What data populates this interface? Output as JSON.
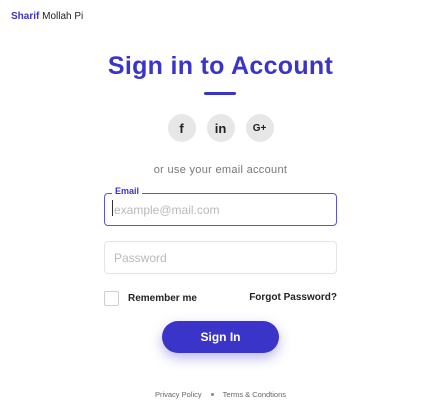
{
  "brand": {
    "part1": "Sharif",
    "part2": " Mollah Pi"
  },
  "title": "Sign in to Account",
  "socials": [
    {
      "icon": "facebook-icon",
      "glyph": "f"
    },
    {
      "icon": "linkedin-icon",
      "glyph": "in"
    },
    {
      "icon": "google-plus-icon",
      "glyph": "G+"
    }
  ],
  "or_text": "or use your email account",
  "email": {
    "label": "Email",
    "value": "",
    "placeholder": "example@mail.com"
  },
  "password": {
    "value": "",
    "placeholder": "Password"
  },
  "remember_label": "Remember me",
  "forgot_label": "Forgot Password?",
  "signin_label": "Sign In",
  "footer": {
    "privacy": "Privacy Policy",
    "terms": "Terms & Condtions"
  },
  "colors": {
    "accent": "#3b34c9",
    "social_bg": "#e7e7e7"
  }
}
